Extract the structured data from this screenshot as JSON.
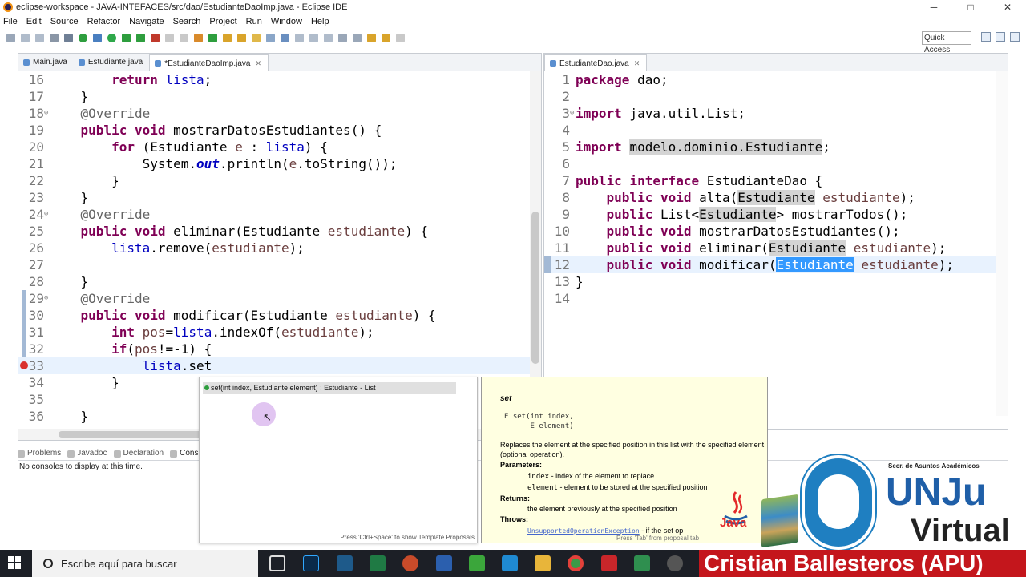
{
  "window": {
    "title": "eclipse-workspace - JAVA-INTEFACES/src/dao/EstudianteDaoImp.java - Eclipse IDE",
    "minimize": "─",
    "maximize": "□",
    "close": "✕"
  },
  "menu": [
    "File",
    "Edit",
    "Source",
    "Refactor",
    "Navigate",
    "Search",
    "Project",
    "Run",
    "Window",
    "Help"
  ],
  "toolbar": {
    "quick_access": "Quick Access"
  },
  "left_editor": {
    "tabs": [
      {
        "label": "Main.java",
        "active": false
      },
      {
        "label": "Estudiante.java",
        "active": false
      },
      {
        "label": "*EstudianteDaoImp.java",
        "active": true,
        "close": "✕"
      }
    ]
  },
  "right_editor": {
    "tabs": [
      {
        "label": "EstudianteDao.java",
        "active": true,
        "close": "✕"
      }
    ]
  },
  "bottom": {
    "tabs": [
      "Problems",
      "Javadoc",
      "Declaration",
      "Cons"
    ],
    "message": "No consoles to display at this time."
  },
  "content_assist": {
    "proposal": "set(int index, Estudiante element) : Estudiante - List",
    "footer": "Press 'Ctrl+Space' to show Template Proposals"
  },
  "javadoc": {
    "title": "set",
    "signature_line1": "E set(int index,",
    "signature_line2": "      E element)",
    "description": "Replaces the element at the specified position in this list with the specified element (optional operation).",
    "parameters_heading": "Parameters:",
    "param1_name": "index",
    "param1_desc": " - index of the element to replace",
    "param2_name": "element",
    "param2_desc": " - element to be stored at the specified position",
    "returns_heading": "Returns:",
    "returns_desc": "the element previously at the specified position",
    "throws_heading": "Throws:",
    "throws_exc": "UnsupportedOperationException",
    "throws_desc": " - if the set op",
    "footer": "Press 'Tab' from proposal tab"
  },
  "branding": {
    "secretaria": "Secr. de Asuntos Académicos",
    "unju": "UNJu",
    "virtual": "Virtual",
    "java": "Java",
    "presenter": "Cristian Ballesteros (APU)"
  },
  "taskbar": {
    "search_placeholder": "Escribe aquí para buscar",
    "apps": [
      "task-view",
      "photoshop",
      "app-blue",
      "excel",
      "powerpoint",
      "word",
      "camtasia",
      "vscode",
      "file-explorer",
      "chrome",
      "acrobat",
      "app-green",
      "settings"
    ]
  },
  "colors": {
    "keyword": "#7f0055",
    "field": "#0000c0",
    "parameter": "#6a3e3e",
    "annotation": "#646464",
    "selection": "#3399ff",
    "presenter_bar": "#c4161c",
    "unju_blue": "#1f5fa8"
  }
}
